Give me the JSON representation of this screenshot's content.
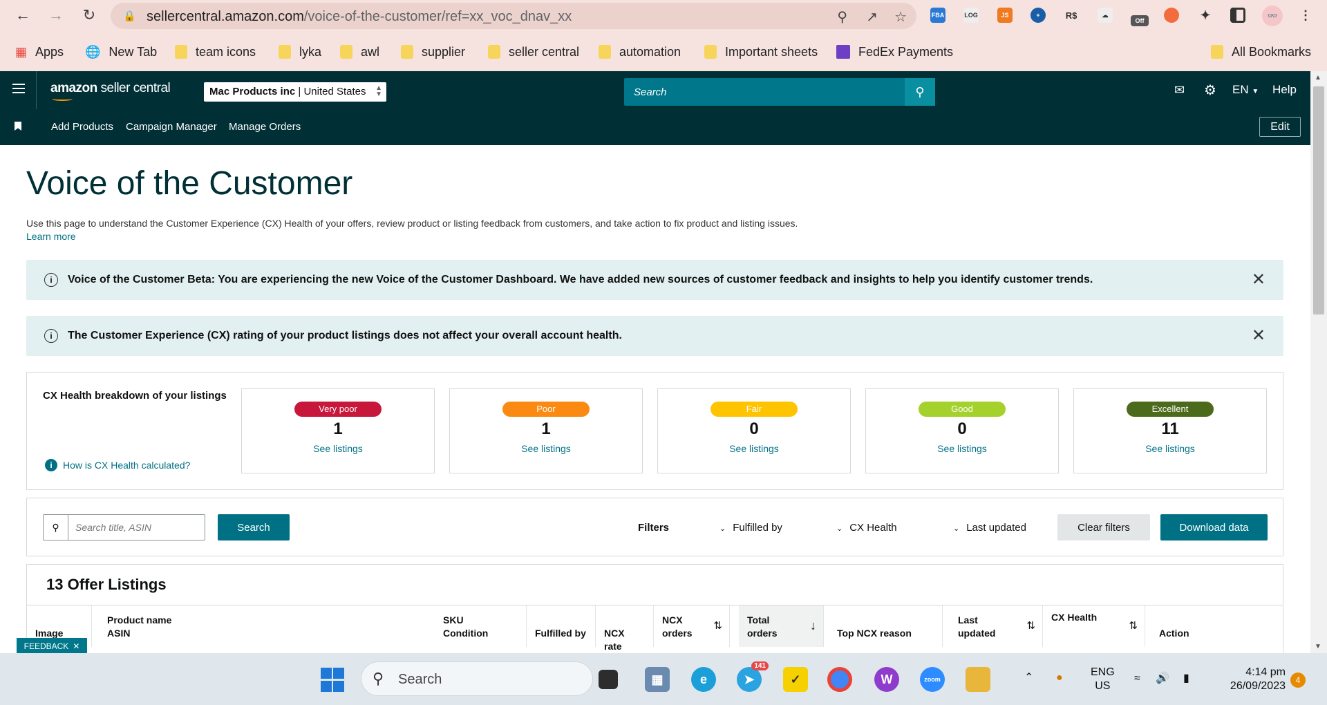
{
  "browser": {
    "url_host": "sellercentral.amazon.com",
    "url_path": "/voice-of-the-customer/ref=xx_voc_dnav_xx",
    "extension_off_badge": "Off",
    "bookmarks": [
      {
        "label": "Apps",
        "icon": "apps-grid-icon"
      },
      {
        "label": "New Tab",
        "icon": "globe-icon"
      },
      {
        "label": "team icons",
        "icon": "folder-icon"
      },
      {
        "label": "lyka",
        "icon": "folder-icon"
      },
      {
        "label": "awl",
        "icon": "folder-icon"
      },
      {
        "label": "supplier",
        "icon": "folder-icon"
      },
      {
        "label": "seller central",
        "icon": "folder-icon"
      },
      {
        "label": "automation",
        "icon": "folder-icon"
      },
      {
        "label": "Important sheets",
        "icon": "folder-icon"
      },
      {
        "label": "FedEx Payments",
        "icon": "sheets-icon"
      }
    ],
    "all_bookmarks": "All Bookmarks"
  },
  "header": {
    "logo_text_bold": "amazon",
    "logo_text": " seller central",
    "account_name": "Mac Products inc",
    "account_region": "United States",
    "search_placeholder": "Search",
    "language": "EN",
    "help": "Help"
  },
  "subnav": {
    "items": [
      "Add Products",
      "Campaign Manager",
      "Manage Orders"
    ],
    "edit": "Edit"
  },
  "page": {
    "title": "Voice of the Customer",
    "description": "Use this page to understand the Customer Experience (CX) Health of your offers, review product or listing feedback from customers, and take action to fix product and listing issues.",
    "learn_more": "Learn more",
    "alert_beta": "Voice of the Customer Beta: You are experiencing the new Voice of the Customer Dashboard. We have added new sources of customer feedback and insights to help you identify customer trends.",
    "alert_rating": "The Customer Experience (CX) rating of your product listings does not affect your overall account health."
  },
  "cx_health": {
    "title": "CX Health breakdown of your listings",
    "how_link": "How is CX Health calculated?",
    "cards": [
      {
        "label": "Very poor",
        "count": "1",
        "link": "See listings",
        "color": "#c7173b"
      },
      {
        "label": "Poor",
        "count": "1",
        "link": "See listings",
        "color": "#fa8a12"
      },
      {
        "label": "Fair",
        "count": "0",
        "link": "See listings",
        "color": "#ffc400"
      },
      {
        "label": "Good",
        "count": "0",
        "link": "See listings",
        "color": "#a4d12c"
      },
      {
        "label": "Excellent",
        "count": "11",
        "link": "See listings",
        "color": "#4c6a1b"
      }
    ]
  },
  "filters": {
    "search_placeholder": "Search title, ASIN",
    "search_button": "Search",
    "label": "Filters",
    "fulfilled_by": "Fulfilled by",
    "cx_health": "CX Health",
    "last_updated": "Last updated",
    "clear": "Clear filters",
    "download": "Download data"
  },
  "listings": {
    "title": "13 Offer Listings",
    "columns": [
      {
        "l1": "",
        "l2": "Image"
      },
      {
        "l1": "Product name",
        "l2": "ASIN"
      },
      {
        "l1": "SKU",
        "l2": "Condition"
      },
      {
        "l1": "",
        "l2": "Fulfilled by"
      },
      {
        "l1": "",
        "l2": "NCX rate"
      },
      {
        "l1": "NCX",
        "l2": "orders"
      },
      {
        "l1": "Total",
        "l2": "orders"
      },
      {
        "l1": "",
        "l2": "Top NCX reason"
      },
      {
        "l1": "Last",
        "l2": "updated"
      },
      {
        "l1": "CX Health",
        "l2": ""
      },
      {
        "l1": "",
        "l2": "Action"
      }
    ]
  },
  "feedback": "FEEDBACK",
  "taskbar": {
    "search": "Search",
    "telegram_badge": "141",
    "lang1": "ENG",
    "lang2": "US",
    "time": "4:14 pm",
    "date": "26/09/2023",
    "notif_count": "4"
  }
}
